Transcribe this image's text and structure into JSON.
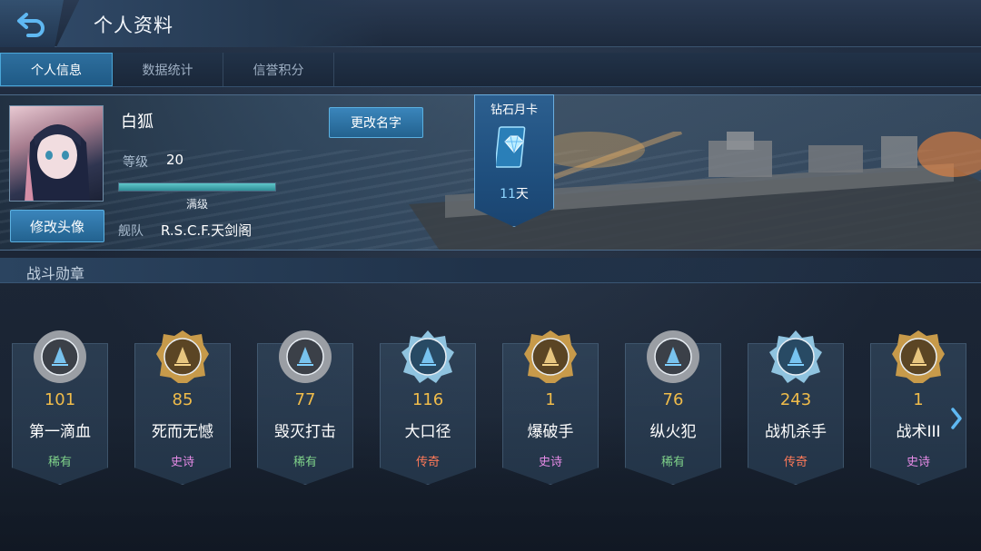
{
  "header": {
    "title": "个人资料"
  },
  "tabs": [
    {
      "label": "个人信息",
      "active": true
    },
    {
      "label": "数据统计",
      "active": false
    },
    {
      "label": "信誉积分",
      "active": false
    }
  ],
  "profile": {
    "name": "白狐",
    "level_label": "等级",
    "level_value": "20",
    "exp_fraction": 1.0,
    "exp_text": "满级",
    "fleet_label": "舰队",
    "fleet_value": "R.S.C.F.天剑阁",
    "change_avatar_label": "修改头像",
    "rename_label": "更改名字"
  },
  "monthly_card": {
    "title": "钻石月卡",
    "days": "11",
    "days_unit": "天",
    "icon": "diamond-card-icon"
  },
  "section": {
    "title": "战斗勋章"
  },
  "medals": [
    {
      "count": "101",
      "name": "第一滴血",
      "rarity": "稀有",
      "icon": "bronze-water-medal-icon"
    },
    {
      "count": "85",
      "name": "死而无憾",
      "rarity": "史诗",
      "icon": "gold-scales-medal-icon"
    },
    {
      "count": "77",
      "name": "毁灭打击",
      "rarity": "稀有",
      "icon": "bronze-explosion-medal-icon"
    },
    {
      "count": "116",
      "name": "大口径",
      "rarity": "传奇",
      "icon": "silver-turret-medal-icon"
    },
    {
      "count": "1",
      "name": "爆破手",
      "rarity": "史诗",
      "icon": "gold-charge-medal-icon"
    },
    {
      "count": "76",
      "name": "纵火犯",
      "rarity": "稀有",
      "icon": "bronze-flame-medal-icon"
    },
    {
      "count": "243",
      "name": "战机杀手",
      "rarity": "传奇",
      "icon": "silver-crosshair-medal-icon"
    },
    {
      "count": "1",
      "name": "战术III",
      "rarity": "史诗",
      "icon": "gold-tactics-medal-icon"
    }
  ],
  "colors": {
    "rarity_rare": "#7fd28a",
    "rarity_epic": "#e58be6",
    "rarity_legend": "#ff7a59",
    "count_gold": "#f0bc4a",
    "accent_blue": "#3a85bb"
  }
}
